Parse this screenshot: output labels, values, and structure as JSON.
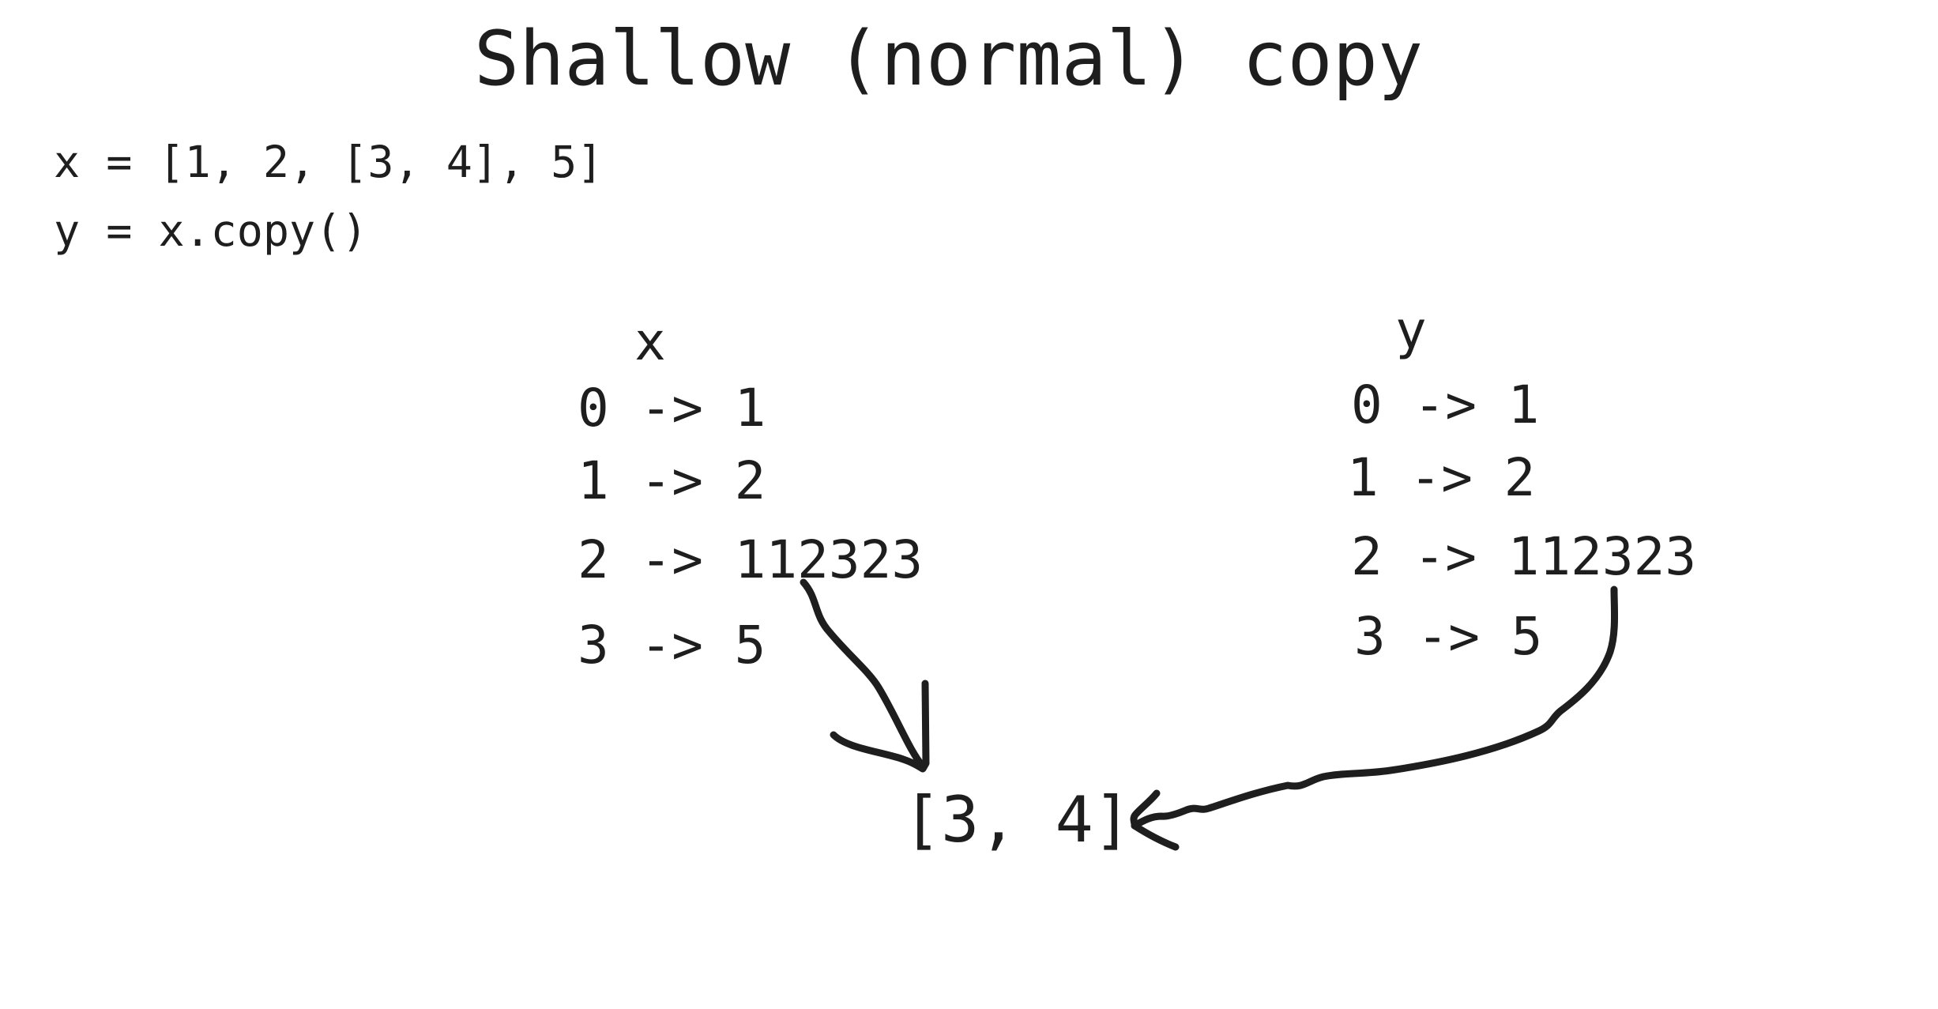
{
  "title": "Shallow (normal) copy",
  "code": {
    "line1": "x = [1, 2, [3, 4], 5]",
    "line2": "y = x.copy()"
  },
  "x_table": {
    "label": "x",
    "rows": [
      "0 -> 1",
      "1 -> 2",
      "2 -> 112323",
      "3 -> 5"
    ]
  },
  "y_table": {
    "label": "y",
    "rows": [
      "0 -> 1",
      "1 -> 2",
      "2 -> 112323",
      "3 -> 5"
    ]
  },
  "shared_object": "[3, 4]",
  "colors": {
    "ink": "#1e1e1e",
    "background": "#ffffff"
  }
}
